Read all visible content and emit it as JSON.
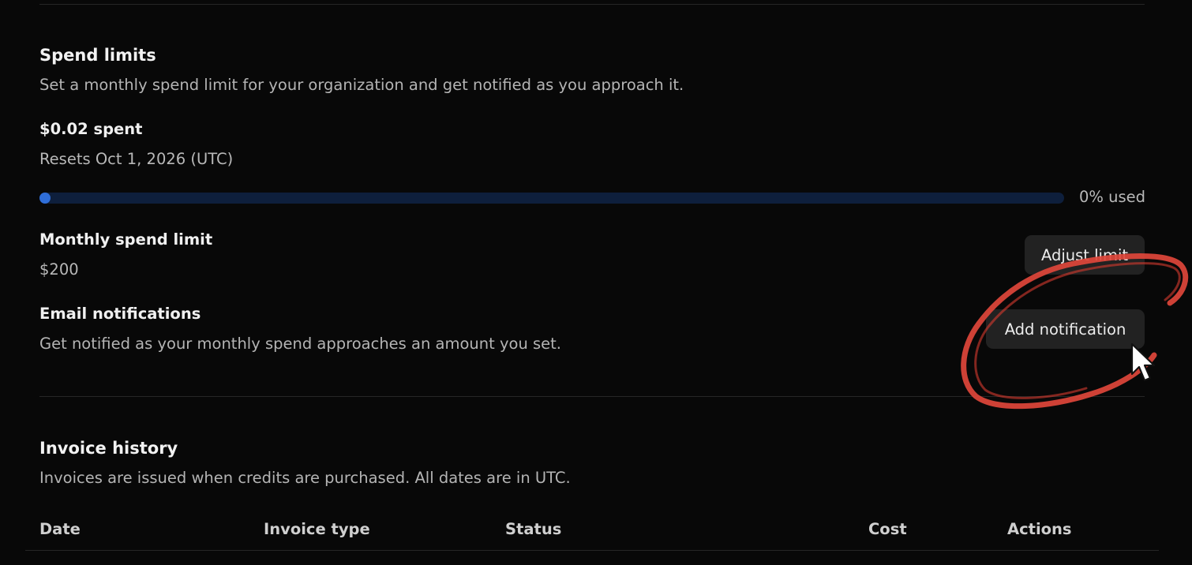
{
  "spend_limits": {
    "title": "Spend limits",
    "description": "Set a monthly spend limit for your organization and get notified as you approach it.",
    "spent": "$0.02 spent",
    "resets": "Resets Oct 1, 2026 (UTC)",
    "usage_fraction": 0.0,
    "usage_label": "0% used",
    "progress_color": "#2f6ed8",
    "track_color": "#0e1f3c"
  },
  "monthly_limit": {
    "label": "Monthly spend limit",
    "value": "$200",
    "adjust_button": "Adjust limit"
  },
  "email_notifications": {
    "label": "Email notifications",
    "description": "Get notified as your monthly spend approaches an amount you set.",
    "add_button": "Add notification"
  },
  "invoice_history": {
    "title": "Invoice history",
    "description": "Invoices are issued when credits are purchased. All dates are in UTC.",
    "columns": [
      "Date",
      "Invoice type",
      "Status",
      "Cost",
      "Actions"
    ]
  },
  "annotation": {
    "color": "#e0473b",
    "icons": [
      "circle-annotation",
      "mouse-cursor-icon"
    ]
  }
}
